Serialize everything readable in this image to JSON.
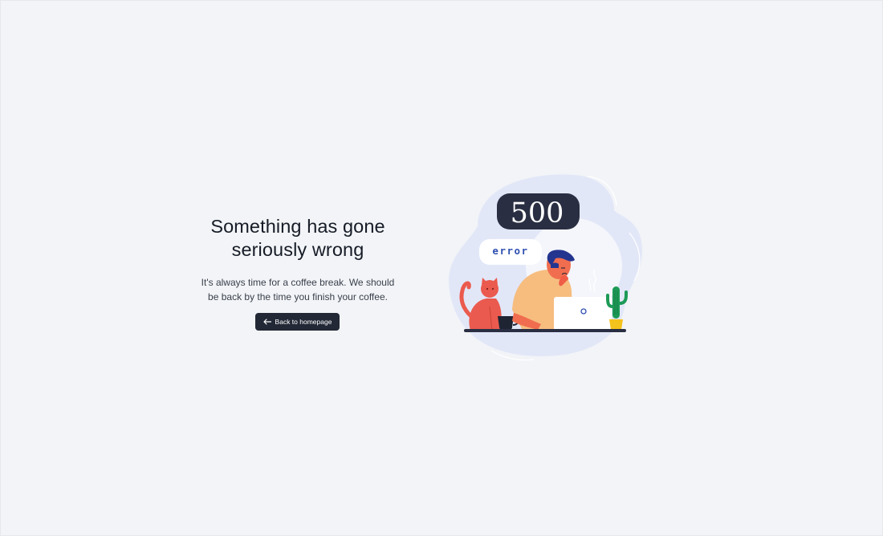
{
  "page": {
    "title": "Something has gone seriously wrong",
    "headline_line1": "Something has gone",
    "headline_line2": "seriously wrong",
    "subtext_line1": "It's always time for a coffee break. We should",
    "subtext_line2": "be back by the time you finish your coffee."
  },
  "button": {
    "label": "Back to homepage",
    "icon": "arrow-left-icon"
  },
  "illustration": {
    "code_label": "500",
    "error_label": "error"
  },
  "colors": {
    "background": "#f2f4f7",
    "button": "#222836",
    "blob": "#e2e7f8",
    "code_bubble": "#292e42",
    "error_text": "#2f4fb0",
    "cat": "#eb5a4e",
    "shirt": "#f6bd7f",
    "hair": "#24358f",
    "cactus": "#1d9a56",
    "pot": "#f4c21c"
  }
}
